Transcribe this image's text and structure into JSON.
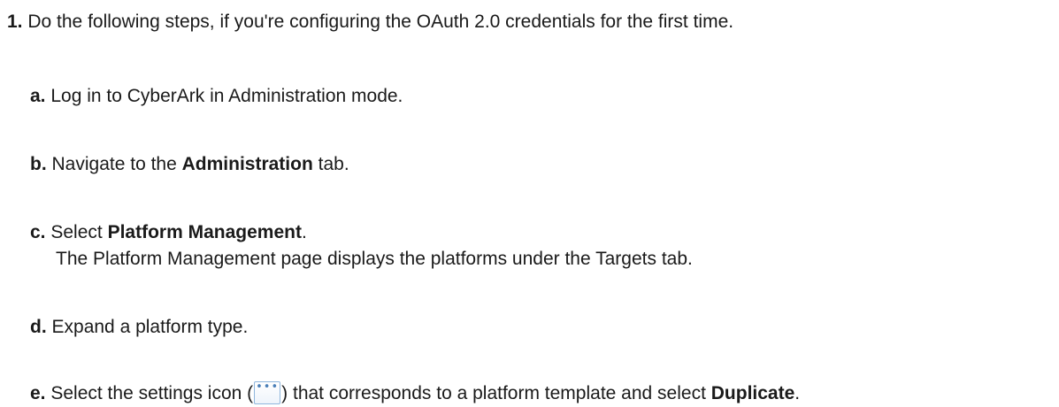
{
  "steps": {
    "s1": {
      "number": "1.",
      "text": "Do the following steps, if you're configuring the OAuth 2.0 credentials for the first time."
    },
    "a": {
      "letter": "a.",
      "text": "Log in to CyberArk in Administration mode."
    },
    "b": {
      "letter": "b.",
      "pre": "Navigate to the",
      "bold": "Administration",
      "post": "tab."
    },
    "c": {
      "letter": "c.",
      "pre": "Select",
      "bold": "Platform Management",
      "post": ".",
      "note": "The Platform Management page displays the platforms under the Targets tab."
    },
    "d": {
      "letter": "d.",
      "text": "Expand a platform type."
    },
    "e": {
      "letter": "e.",
      "pre": "Select the settings icon (",
      "mid": ") that corresponds to a platform template and select",
      "bold": "Duplicate",
      "post": ".",
      "icon": "ellipsis-settings-icon"
    }
  }
}
